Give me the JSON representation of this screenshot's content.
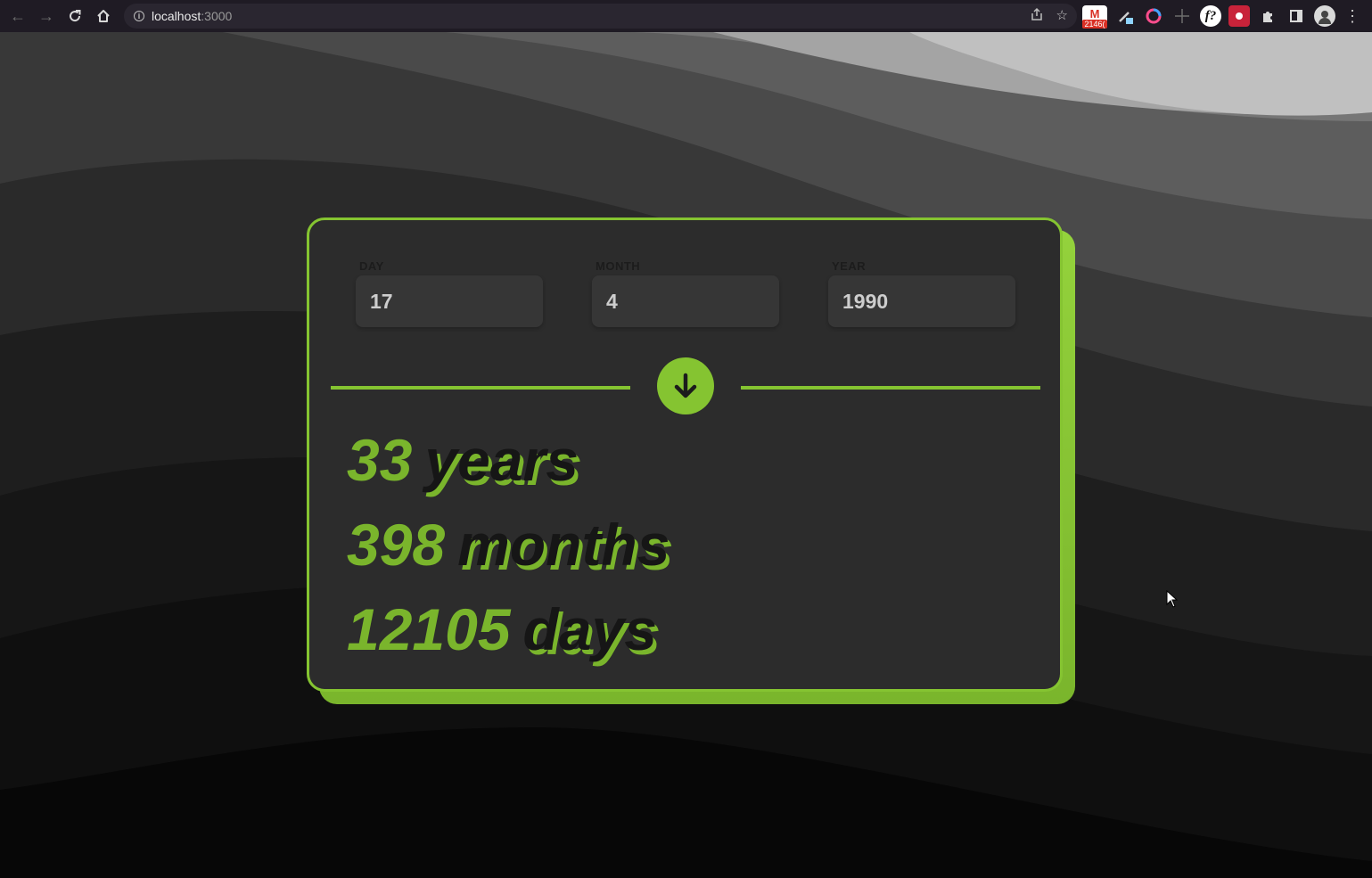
{
  "browser": {
    "url_host": "localhost",
    "url_port": ":3000",
    "extensions": {
      "gmail_badge": "2146("
    }
  },
  "form": {
    "day": {
      "label": "DAY",
      "value": "17"
    },
    "month": {
      "label": "MONTH",
      "value": "4"
    },
    "year": {
      "label": "YEAR",
      "value": "1990"
    }
  },
  "results": [
    {
      "number": "33",
      "unit": "years"
    },
    {
      "number": "398",
      "unit": "months"
    },
    {
      "number": "12105",
      "unit": "days"
    }
  ],
  "colors": {
    "accent": "#85c431",
    "card_bg": "#2c2c2c",
    "chrome_bg": "#1f1b24"
  }
}
